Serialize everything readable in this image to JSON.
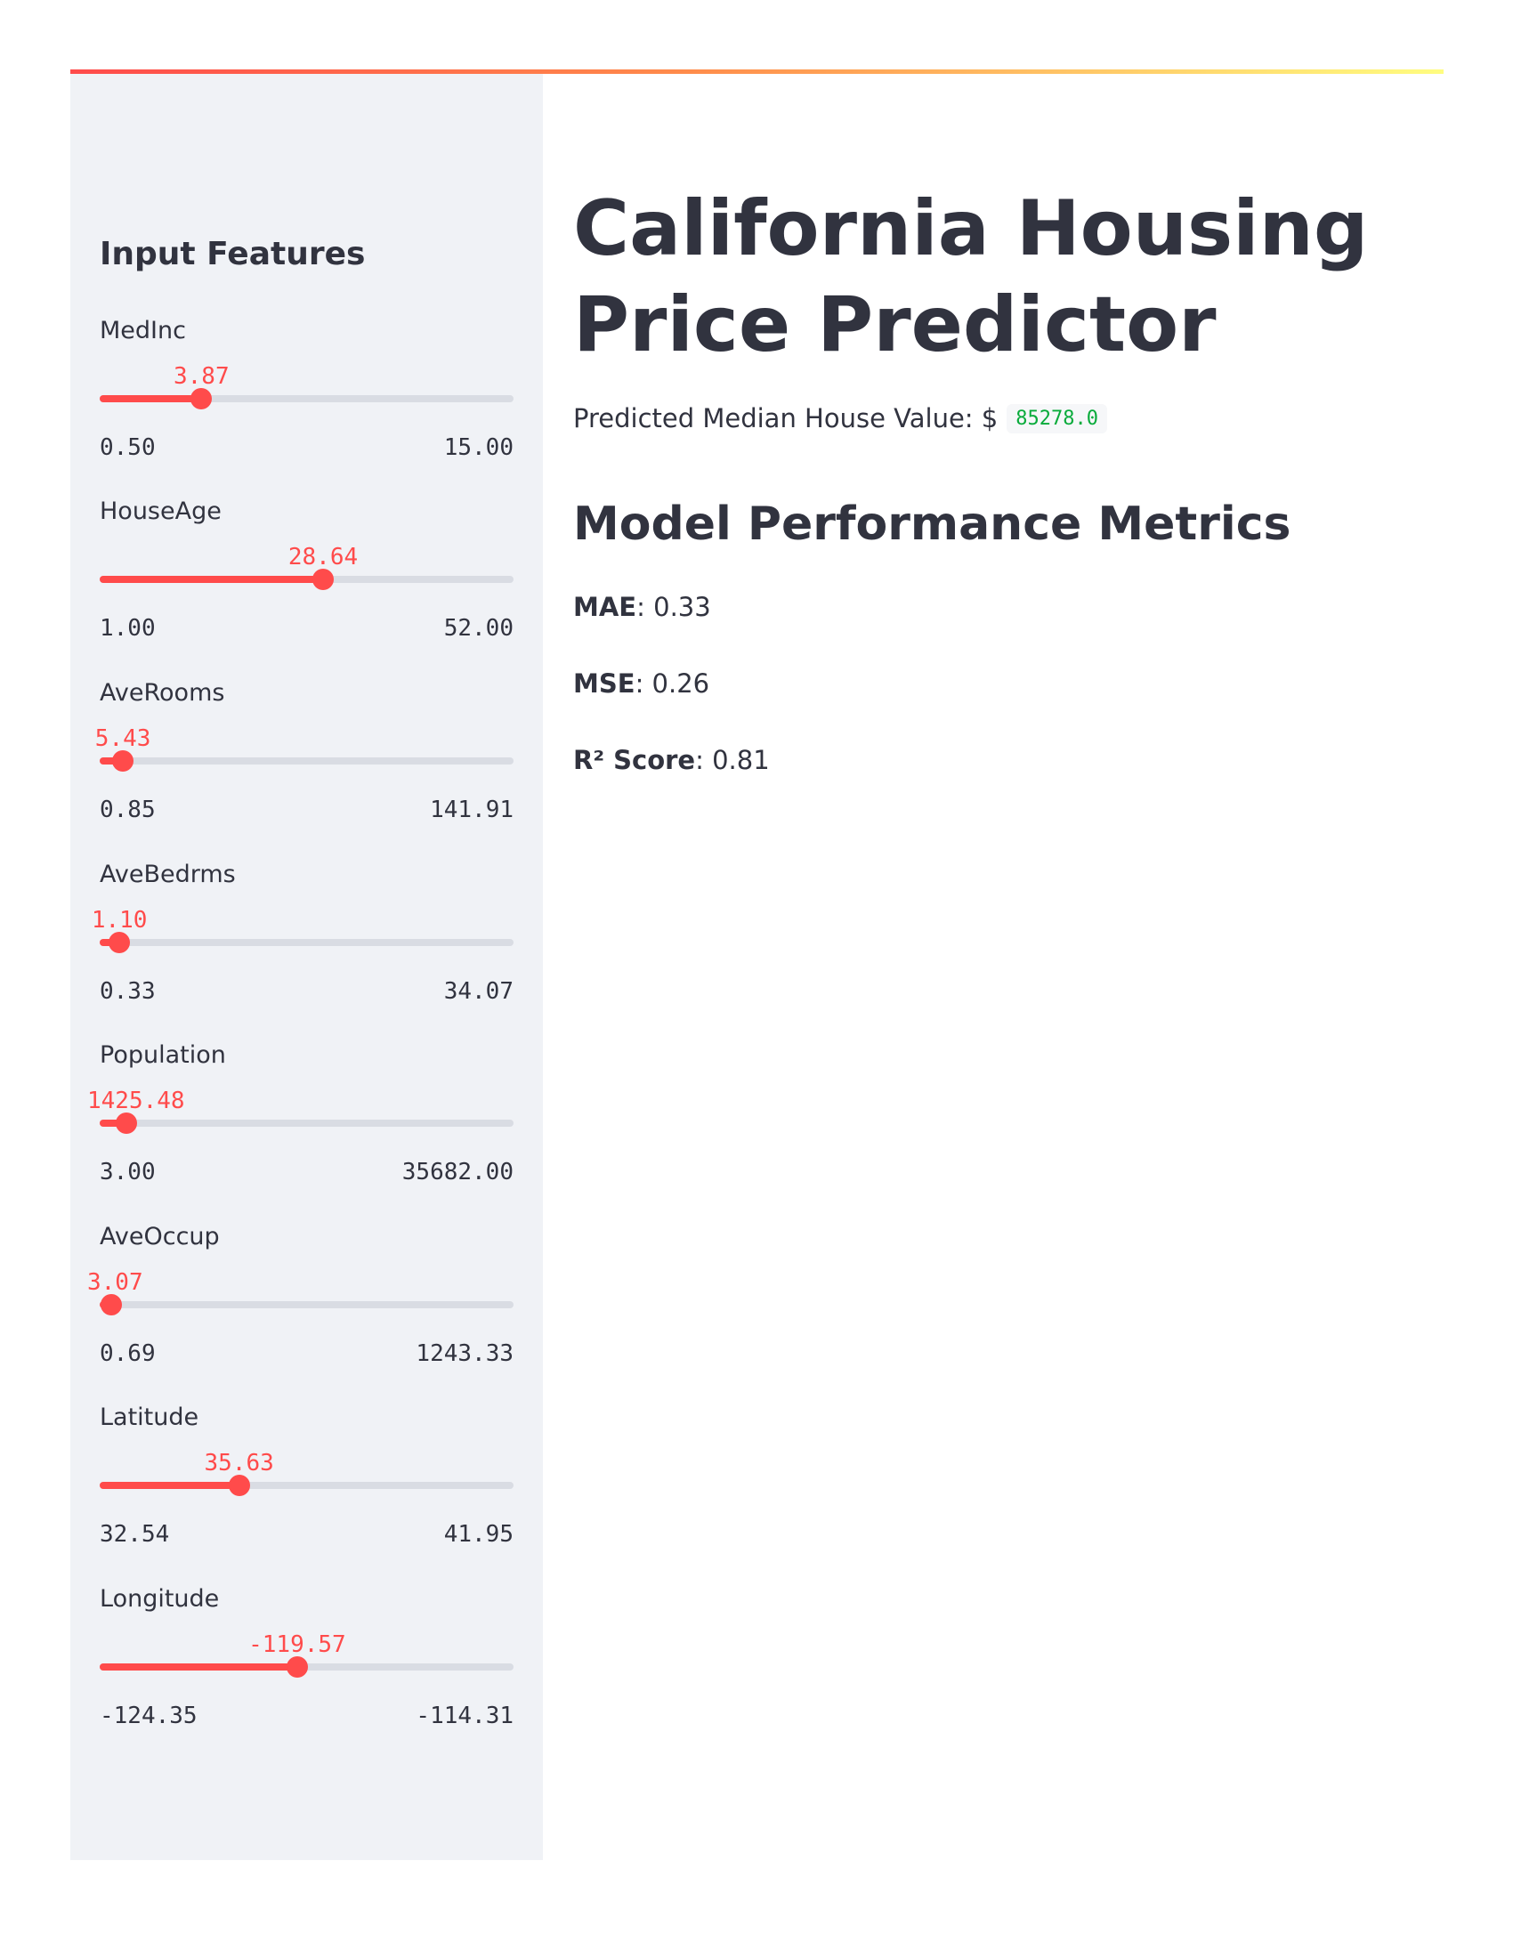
{
  "sidebar": {
    "header": "Input Features",
    "sliders": [
      {
        "label": "MedInc",
        "value": "3.87",
        "min": "0.50",
        "max": "15.00",
        "fraction": 0.232
      },
      {
        "label": "HouseAge",
        "value": "28.64",
        "min": "1.00",
        "max": "52.00",
        "fraction": 0.542
      },
      {
        "label": "AveRooms",
        "value": "5.43",
        "min": "0.85",
        "max": "141.91",
        "fraction": 0.032
      },
      {
        "label": "AveBedrms",
        "value": "1.10",
        "min": "0.33",
        "max": "34.07",
        "fraction": 0.023
      },
      {
        "label": "Population",
        "value": "1425.48",
        "min": "3.00",
        "max": "35682.00",
        "fraction": 0.04
      },
      {
        "label": "AveOccup",
        "value": "3.07",
        "min": "0.69",
        "max": "1243.33",
        "fraction": 0.002
      },
      {
        "label": "Latitude",
        "value": "35.63",
        "min": "32.54",
        "max": "41.95",
        "fraction": 0.328
      },
      {
        "label": "Longitude",
        "value": "-119.57",
        "min": "-124.35",
        "max": "-114.31",
        "fraction": 0.476
      }
    ]
  },
  "main": {
    "title_line1": "California Housing",
    "title_line2": "Price Predictor",
    "prediction_label": "Predicted Median House Value: $",
    "prediction_value": "85278.0",
    "metrics_header": "Model Performance Metrics",
    "metrics": [
      {
        "name": "MAE",
        "value": ": 0.33"
      },
      {
        "name": "MSE",
        "value": ": 0.26"
      },
      {
        "name": "R² Score",
        "value": ": 0.81"
      }
    ]
  },
  "colors": {
    "accent": "#ff4b4b",
    "sidebar_bg": "#f0f2f6",
    "track": "#d9dce3",
    "code_text": "#09ab3b",
    "text": "#31333f"
  }
}
